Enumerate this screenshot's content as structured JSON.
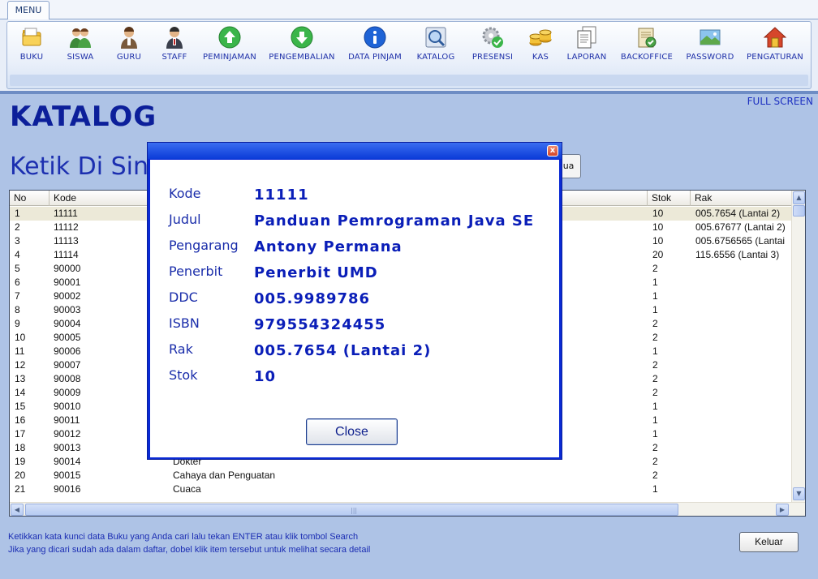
{
  "menu": {
    "tab_label": "MENU",
    "items": [
      {
        "label": "BUKU",
        "icon": "folder-icon"
      },
      {
        "label": "SISWA",
        "icon": "students-icon"
      },
      {
        "label": "GURU",
        "icon": "teacher-icon"
      },
      {
        "label": "STAFF",
        "icon": "staff-icon"
      },
      {
        "label": "PEMINJAMAN",
        "icon": "arrow-up-icon"
      },
      {
        "label": "PENGEMBALIAN",
        "icon": "arrow-down-icon"
      },
      {
        "label": "DATA PINJAM",
        "icon": "info-icon"
      },
      {
        "label": "KATALOG",
        "icon": "catalog-search-icon"
      },
      {
        "label": "PRESENSI",
        "icon": "gear-check-icon"
      },
      {
        "label": "KAS",
        "icon": "coins-icon"
      },
      {
        "label": "LAPORAN",
        "icon": "documents-icon"
      },
      {
        "label": "BACKOFFICE",
        "icon": "office-icon"
      },
      {
        "label": "PASSWORD",
        "icon": "password-icon"
      },
      {
        "label": "PENGATURAN",
        "icon": "home-icon"
      }
    ]
  },
  "page": {
    "full_screen_label": "FULL SCREEN",
    "title": "KATALOG",
    "search_label": "Ketik Di Sin",
    "search_button_partial": "mua"
  },
  "table": {
    "headers": [
      "No",
      "Kode",
      "",
      "Stok",
      "Rak"
    ],
    "rows": [
      {
        "no": "1",
        "kode": "11111",
        "judul": "",
        "stok": "10",
        "rak": "005.7654 (Lantai 2)"
      },
      {
        "no": "2",
        "kode": "11112",
        "judul": "",
        "stok": "10",
        "rak": "005.67677 (Lantai 2)"
      },
      {
        "no": "3",
        "kode": "11113",
        "judul": "",
        "stok": "10",
        "rak": "005.6756565 (Lantai"
      },
      {
        "no": "4",
        "kode": "11114",
        "judul": "",
        "stok": "20",
        "rak": "115.6556 (Lantai 3)"
      },
      {
        "no": "5",
        "kode": "90000",
        "judul": "",
        "stok": "2",
        "rak": ""
      },
      {
        "no": "6",
        "kode": "90001",
        "judul": "",
        "stok": "1",
        "rak": ""
      },
      {
        "no": "7",
        "kode": "90002",
        "judul": "",
        "stok": "1",
        "rak": ""
      },
      {
        "no": "8",
        "kode": "90003",
        "judul": "",
        "stok": "1",
        "rak": ""
      },
      {
        "no": "9",
        "kode": "90004",
        "judul": "",
        "stok": "2",
        "rak": ""
      },
      {
        "no": "10",
        "kode": "90005",
        "judul": "",
        "stok": "2",
        "rak": ""
      },
      {
        "no": "11",
        "kode": "90006",
        "judul": "",
        "stok": "1",
        "rak": ""
      },
      {
        "no": "12",
        "kode": "90007",
        "judul": "",
        "stok": "2",
        "rak": ""
      },
      {
        "no": "13",
        "kode": "90008",
        "judul": "",
        "stok": "2",
        "rak": ""
      },
      {
        "no": "14",
        "kode": "90009",
        "judul": "",
        "stok": "2",
        "rak": ""
      },
      {
        "no": "15",
        "kode": "90010",
        "judul": "",
        "stok": "1",
        "rak": ""
      },
      {
        "no": "16",
        "kode": "90011",
        "judul": "",
        "stok": "1",
        "rak": ""
      },
      {
        "no": "17",
        "kode": "90012",
        "judul": "",
        "stok": "1",
        "rak": ""
      },
      {
        "no": "18",
        "kode": "90013",
        "judul": "",
        "stok": "2",
        "rak": ""
      },
      {
        "no": "19",
        "kode": "90014",
        "judul": "Dokter",
        "stok": "2",
        "rak": ""
      },
      {
        "no": "20",
        "kode": "90015",
        "judul": "Cahaya dan Penguatan",
        "stok": "2",
        "rak": ""
      },
      {
        "no": "21",
        "kode": "90016",
        "judul": "Cuaca",
        "stok": "1",
        "rak": ""
      }
    ]
  },
  "footer": {
    "hint_line_1": "Ketikkan kata kunci data Buku yang Anda cari lalu tekan ENTER atau klik tombol Search",
    "hint_line_2": "Jika yang dicari sudah ada dalam daftar, dobel klik item tersebut untuk melihat secara detail",
    "keluar_label": "Keluar"
  },
  "dialog": {
    "close_x": "x",
    "fields": [
      {
        "label": "Kode",
        "value": "11111"
      },
      {
        "label": "Judul",
        "value": "Panduan Pemrograman Java SE"
      },
      {
        "label": "Pengarang",
        "value": "Antony Permana"
      },
      {
        "label": "Penerbit",
        "value": "Penerbit UMD"
      },
      {
        "label": "DDC",
        "value": "005.9989786"
      },
      {
        "label": "ISBN",
        "value": "979554324455"
      },
      {
        "label": "Rak",
        "value": "005.7654 (Lantai 2)"
      },
      {
        "label": "Stok",
        "value": "10"
      }
    ],
    "close_button_label": "Close"
  },
  "colors": {
    "background": "#aec3e6",
    "title_blue": "#0c1f9a",
    "dialog_border": "#0a2ad4",
    "dialog_value": "#0a1eb8"
  }
}
